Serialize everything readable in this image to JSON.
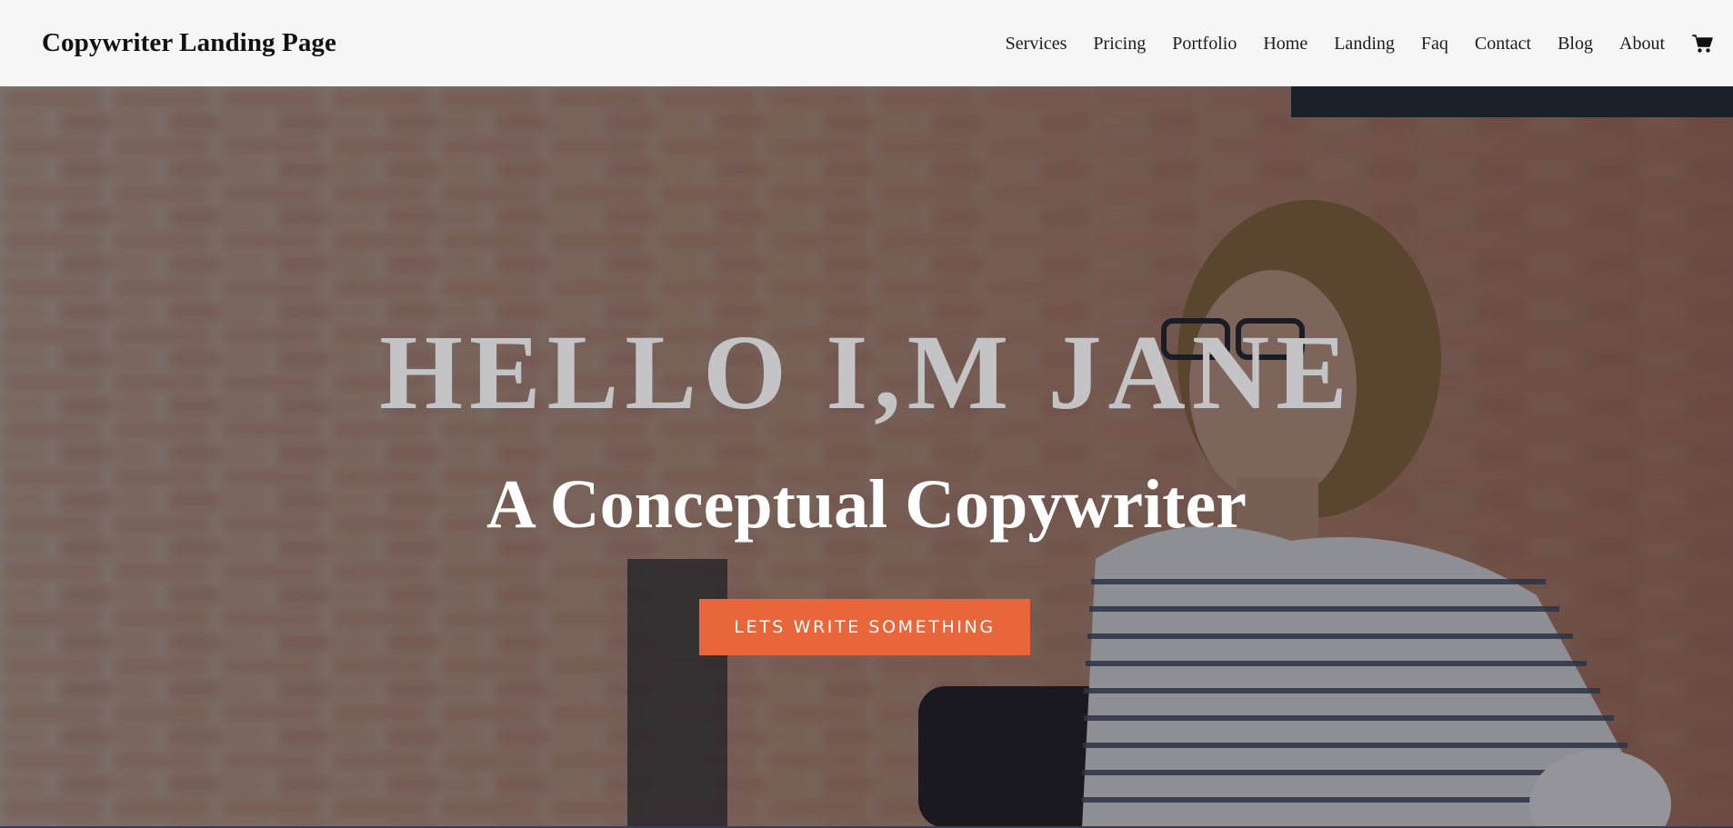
{
  "header": {
    "brand": "Copywriter Landing Page",
    "nav": [
      "Services",
      "Pricing",
      "Portfolio",
      "Home",
      "Landing",
      "Faq",
      "Contact",
      "Blog",
      "About"
    ],
    "cart_icon": "shopping-cart-icon"
  },
  "hero": {
    "title": "HELLO I,M JANE",
    "subtitle": "A Conceptual Copywriter",
    "cta_label": "LETS WRITE SOMETHING"
  },
  "colors": {
    "header_bg": "#f6f6f6",
    "cta_bg": "#e9653a",
    "title_color": "#c4c3c5"
  }
}
